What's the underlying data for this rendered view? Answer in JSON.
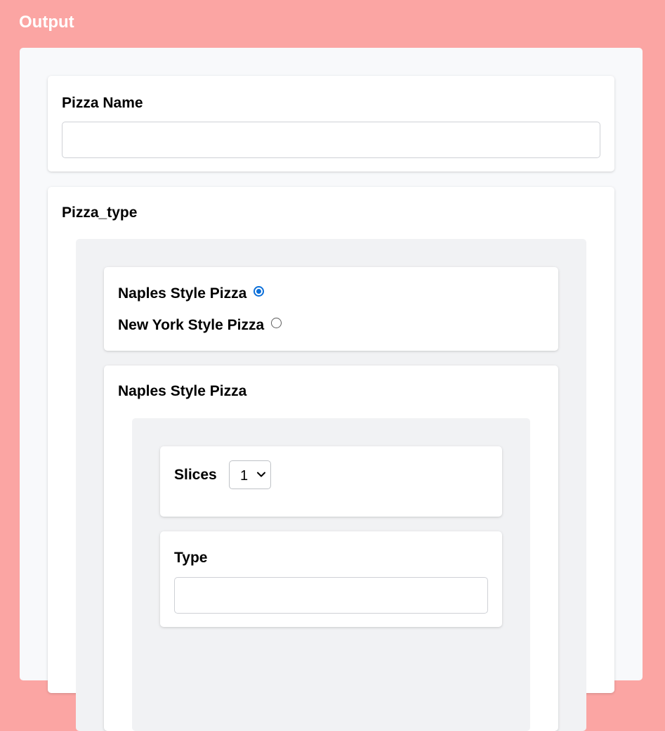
{
  "header": {
    "title": "Output"
  },
  "form": {
    "pizza_name": {
      "label": "Pizza Name",
      "value": "",
      "placeholder": ""
    },
    "pizza_type": {
      "label": "Pizza_type",
      "options": [
        {
          "label": "Naples Style Pizza",
          "selected": true
        },
        {
          "label": "New York Style Pizza",
          "selected": false
        }
      ],
      "selected_section": {
        "title": "Naples Style Pizza",
        "slices": {
          "label": "Slices",
          "value": "1"
        },
        "type": {
          "label": "Type",
          "value": "",
          "placeholder": ""
        }
      }
    }
  },
  "icons": {
    "radio_checked": "radio-checked-icon",
    "radio_unchecked": "radio-unchecked-icon",
    "select_chevron": "chevron-down-icon"
  },
  "colors": {
    "page_background": "#fba5a3",
    "panel_background": "#f8f9fb",
    "card_background": "#ffffff",
    "nested_panel": "#f1f2f4",
    "radio_accent": "#0b6fd9"
  }
}
